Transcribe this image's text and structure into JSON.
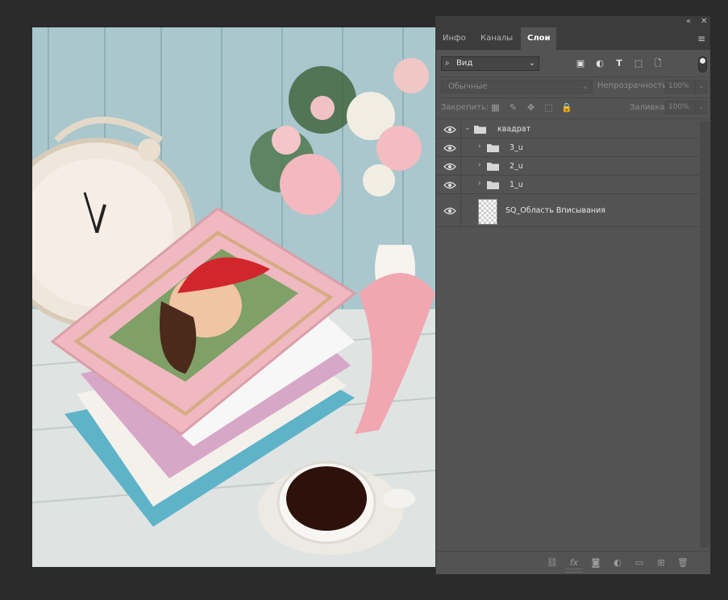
{
  "panel": {
    "collapse_glyph": "«",
    "close_glyph": "✕",
    "tabs": [
      {
        "label": "Инфо",
        "active": false
      },
      {
        "label": "Каналы",
        "active": false
      },
      {
        "label": "Слои",
        "active": true
      }
    ],
    "menu_glyph": "≡",
    "filter": {
      "kind": "Вид",
      "icon_glyphs": [
        "▣",
        "◐",
        "T",
        "⬚",
        "🗋"
      ]
    },
    "blend_mode": "Обычные",
    "opacity_label": "Непрозрачность:",
    "opacity_value": "100%",
    "lock_label": "Закрепить:",
    "lock_glyphs": [
      "▦",
      "✎",
      "✥",
      "⬚",
      "🔒"
    ],
    "fill_label": "Заливка:",
    "fill_value": "100%",
    "layers": [
      {
        "name": "квадрат",
        "type": "group",
        "expanded": true,
        "visible": true
      },
      {
        "name": "3_u",
        "type": "group",
        "expanded": false,
        "visible": true
      },
      {
        "name": "2_u",
        "type": "group",
        "expanded": false,
        "visible": true
      },
      {
        "name": "1_u",
        "type": "group",
        "expanded": false,
        "visible": true
      },
      {
        "name": "SQ_Область Вписывания",
        "type": "smart-object",
        "visible": true
      }
    ],
    "bottom_glyphs": [
      "⛓",
      "fx",
      "◙",
      "◐",
      "▭",
      "⊞",
      "🗑"
    ]
  },
  "colors": {
    "panel_bg": "#535353",
    "tab_bar": "#3c3c3c",
    "app_bg": "#2b2b2b"
  }
}
